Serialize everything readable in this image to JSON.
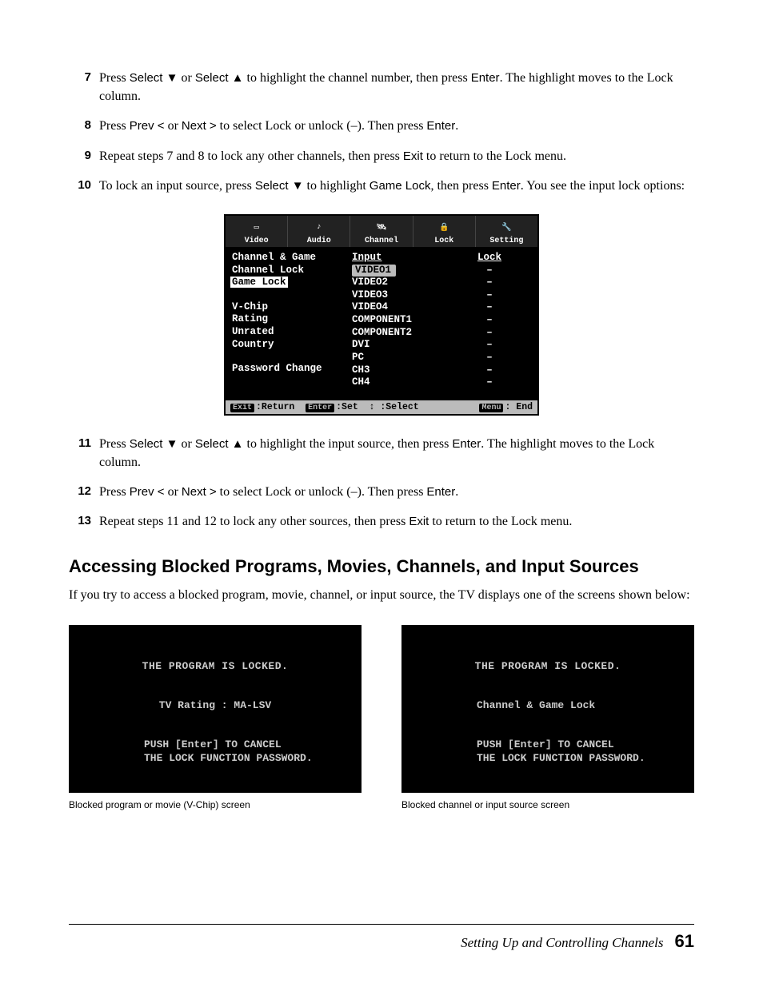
{
  "steps_top": [
    {
      "n": "7",
      "text_before": "Press ",
      "k1": "Select ▼",
      "mid1": " or ",
      "k2": "Select ▲",
      "mid2": " to highlight the channel number, then press ",
      "k3": "Enter",
      "after": ". The highlight moves to the Lock column."
    },
    {
      "n": "8",
      "text_before": "Press ",
      "k1": "Prev <",
      "mid1": " or ",
      "k2": "Next >",
      "mid2": " to select Lock or unlock (–). Then press ",
      "k3": "Enter",
      "after": "."
    },
    {
      "n": "9",
      "text_before": "Repeat steps 7 and 8 to lock any other channels, then press ",
      "k1": "Exit",
      "mid1": " to return to the Lock menu.",
      "k2": "",
      "mid2": "",
      "k3": "",
      "after": ""
    },
    {
      "n": "10",
      "text_before": "To lock an input source, press ",
      "k1": "Select ▼",
      "mid1": " to highlight ",
      "k2": "Game Lock",
      "mid2": ", then press ",
      "k3": "Enter",
      "after": ". You see the input lock options:"
    }
  ],
  "steps_bottom": [
    {
      "n": "11",
      "text_before": "Press ",
      "k1": "Select ▼",
      "mid1": " or ",
      "k2": "Select ▲",
      "mid2": " to highlight the input source, then press ",
      "k3": "Enter",
      "after": ". The highlight moves to the Lock column."
    },
    {
      "n": "12",
      "text_before": "Press ",
      "k1": "Prev <",
      "mid1": " or ",
      "k2": "Next >",
      "mid2": " to select Lock or unlock (–). Then press ",
      "k3": "Enter",
      "after": "."
    },
    {
      "n": "13",
      "text_before": "Repeat steps 11 and 12 to lock any other sources, then press ",
      "k1": "Exit",
      "mid1": " to return to the Lock menu.",
      "k2": "",
      "mid2": "",
      "k3": "",
      "after": ""
    }
  ],
  "osd": {
    "tabs": [
      "Video",
      "Audio",
      "Channel",
      "Lock",
      "Setting"
    ],
    "left_items": [
      "Channel & Game",
      "Channel Lock",
      "Game Lock",
      "",
      "V-Chip",
      "Rating",
      "Unrated",
      "Country",
      "",
      "Password Change"
    ],
    "menu_selected_index": 2,
    "input_header": "Input",
    "lock_header": "Lock",
    "inputs": [
      "VIDEO1",
      "VIDEO2",
      "VIDEO3",
      "VIDEO4",
      "COMPONENT1",
      "COMPONENT2",
      "DVI",
      "PC",
      "CH3",
      "CH4"
    ],
    "input_selected_index": 0,
    "lock_values": [
      "–",
      "–",
      "–",
      "–",
      "–",
      "–",
      "–",
      "–",
      "–",
      "–"
    ],
    "status_left": "Exit :Return  Enter :Set  ↕ :Select",
    "status_right": "Menu : End"
  },
  "heading": "Accessing Blocked Programs, Movies, Channels, and Input Sources",
  "intro": "If you try to access a blocked program, movie, channel, or input source, the TV displays one of the screens shown below:",
  "lock1": {
    "l1": "THE PROGRAM IS LOCKED.",
    "l2": "TV Rating : MA-LSV",
    "l3a": "PUSH [Enter] TO CANCEL",
    "l3b": "THE LOCK FUNCTION PASSWORD.",
    "caption": "Blocked program or movie (V-Chip) screen"
  },
  "lock2": {
    "l1": "THE PROGRAM IS LOCKED.",
    "l2": "Channel & Game Lock",
    "l3a": "PUSH [Enter] TO CANCEL",
    "l3b": "THE LOCK FUNCTION PASSWORD.",
    "caption": "Blocked channel or input source screen"
  },
  "footer": {
    "section": "Setting Up and Controlling Channels",
    "page": "61"
  }
}
